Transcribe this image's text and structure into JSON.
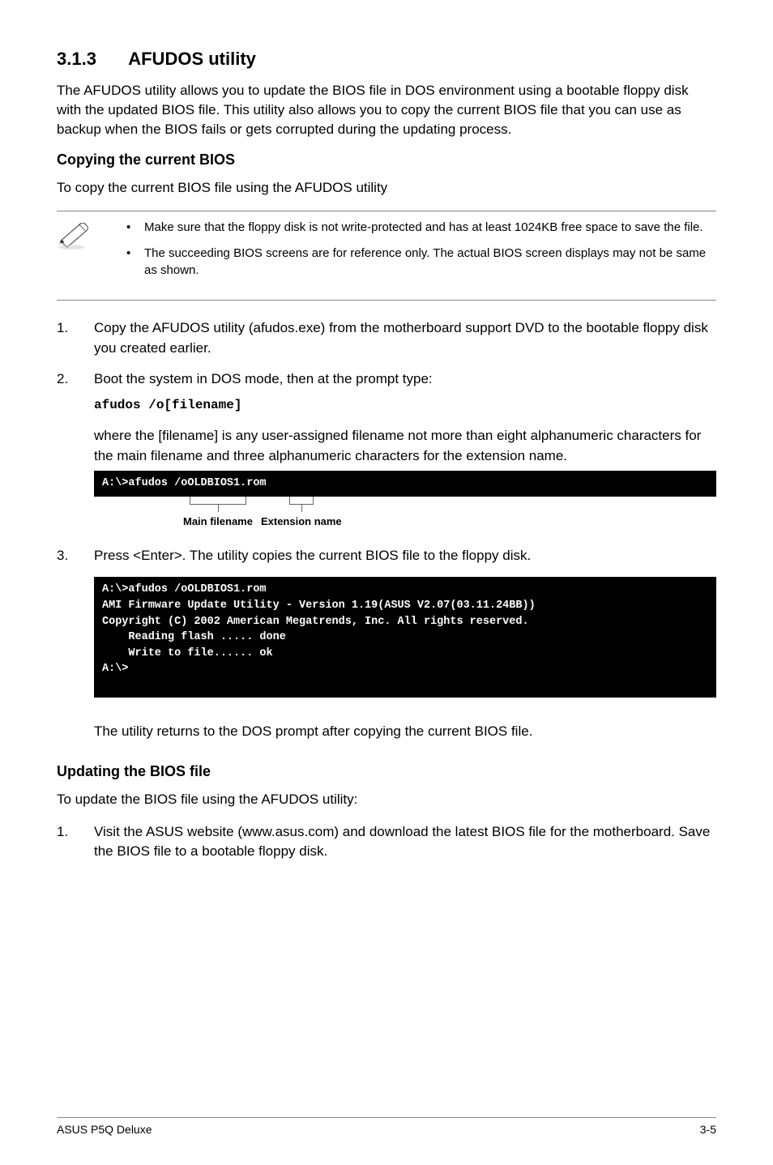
{
  "heading": {
    "number": "3.1.3",
    "title": "AFUDOS utility"
  },
  "intro": "The AFUDOS utility allows you to update the BIOS file in DOS environment using a bootable floppy disk with the updated BIOS file. This utility also allows you to copy the current BIOS file that you can use as backup when the BIOS fails or gets corrupted during the updating process.",
  "copying": {
    "heading": "Copying the current BIOS",
    "lead": "To copy the current BIOS file using the AFUDOS utility",
    "notes": [
      "Make sure that the floppy disk is not write-protected and has at least 1024KB free space to save the file.",
      "The succeeding BIOS screens are for reference only. The actual BIOS screen displays may not be same as shown."
    ],
    "steps": {
      "s1": "Copy the AFUDOS utility (afudos.exe) from the motherboard support DVD to the bootable floppy disk you created earlier.",
      "s2": "Boot the system in DOS mode, then at the prompt type:",
      "s2_code": "afudos /o[filename]",
      "s2_explain": "where the [filename] is any user-assigned filename not more than eight alphanumeric characters  for the main filename and three alphanumeric characters for the extension name.",
      "s3": "Press <Enter>. The utility copies the current BIOS file to the floppy disk."
    },
    "terminal1": "A:\\>afudos /oOLDBIOS1.rom",
    "annot": {
      "main": "Main filename",
      "ext": "Extension name"
    },
    "terminal2": "A:\\>afudos /oOLDBIOS1.rom\nAMI Firmware Update Utility - Version 1.19(ASUS V2.07(03.11.24BB))\nCopyright (C) 2002 American Megatrends, Inc. All rights reserved.\n    Reading flash ..... done\n    Write to file...... ok\nA:\\>\n ",
    "after": "The utility returns to the DOS prompt after copying the current BIOS file."
  },
  "updating": {
    "heading": "Updating the BIOS file",
    "lead": "To update the BIOS file using the AFUDOS utility:",
    "steps": {
      "s1": "Visit the ASUS website (www.asus.com) and download the latest BIOS file for the motherboard. Save the BIOS file to a bootable floppy disk."
    }
  },
  "footer": {
    "left": "ASUS P5Q Deluxe",
    "right": "3-5"
  }
}
